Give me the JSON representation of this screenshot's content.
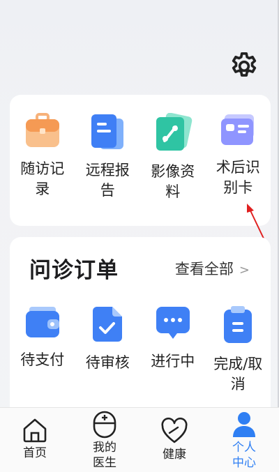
{
  "header": {
    "settings_icon": "gear-icon"
  },
  "services": [
    {
      "label": "随访记录",
      "icon": "briefcase-icon",
      "color": "#f7a25a"
    },
    {
      "label": "远程报告",
      "icon": "report-icon",
      "color": "#3f7ff5"
    },
    {
      "label": "影像资料",
      "icon": "image-icon",
      "color": "#2fc4a3"
    },
    {
      "label": "术后识别卡",
      "icon": "id-card-icon",
      "color": "#8f95ff"
    }
  ],
  "orders": {
    "title": "问诊订单",
    "view_all": "查看全部",
    "items": [
      {
        "label": "待支付",
        "icon": "wallet-icon"
      },
      {
        "label": "待审核",
        "icon": "review-icon"
      },
      {
        "label": "进行中",
        "icon": "chat-icon"
      },
      {
        "label": "完成/取消",
        "icon": "clipboard-icon"
      }
    ]
  },
  "tabbar": [
    {
      "label": "首页",
      "icon": "home-icon",
      "active": false
    },
    {
      "label": "我的医生",
      "icon": "doctor-icon",
      "active": false
    },
    {
      "label": "健康",
      "icon": "heart-icon",
      "active": false
    },
    {
      "label": "个人中心",
      "icon": "user-icon",
      "active": true
    }
  ],
  "colors": {
    "accent": "#2f7ff3",
    "annotation_arrow": "#e02020"
  }
}
